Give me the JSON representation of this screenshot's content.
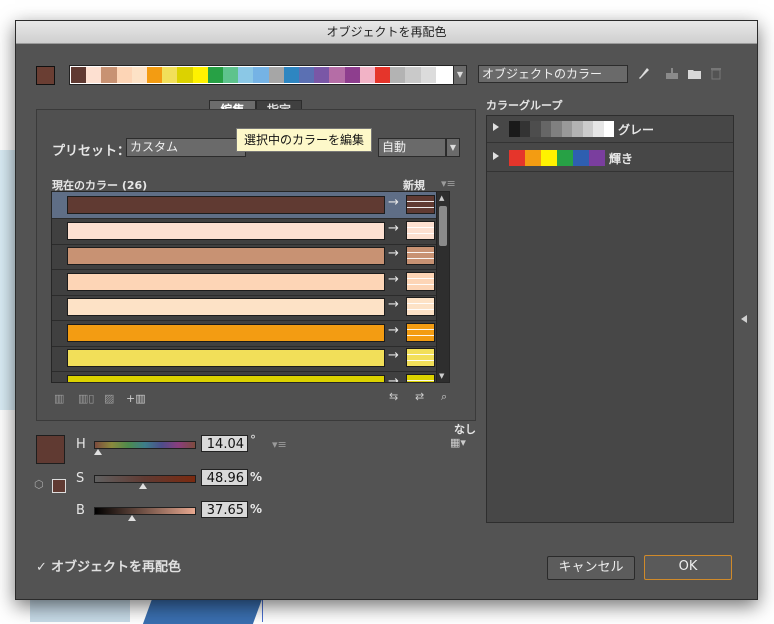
{
  "dialog": {
    "title": "オブジェクトを再配色"
  },
  "top": {
    "current_swatch_color": "#6a3e33",
    "strip_colors": [
      "#603a32",
      "#fde0d1",
      "#c89273",
      "#fdd5b6",
      "#fde2c6",
      "#f39c12",
      "#f2df59",
      "#dcd200",
      "#fff200",
      "#27a145",
      "#5ec38d",
      "#8bc8e6",
      "#75b3e5",
      "#a6a6a6",
      "#2e86c1",
      "#5b70b3",
      "#7a57a6",
      "#b56da6",
      "#8e3e8e",
      "#f2b3c6",
      "#e5352b",
      "#b3b3b3",
      "#c9c9c9",
      "#dcdcdc",
      "#ffffff"
    ],
    "object_color_dropdown": "オブジェクトのカラー",
    "icons": [
      "eyedropper-icon",
      "new-group-icon",
      "folder-icon",
      "trash-icon"
    ]
  },
  "tabs": {
    "edit": "編集",
    "assign": "指定"
  },
  "tooltip": "選択中のカラーを編集",
  "preset": {
    "label": "プリセット：",
    "value": "カスタム",
    "auto": "自動"
  },
  "current_colors": {
    "label": "現在のカラー (26)",
    "new_label": "新規",
    "rows": [
      {
        "color": "#603a32",
        "selected": true
      },
      {
        "color": "#fde0d1",
        "selected": false
      },
      {
        "color": "#c89273",
        "selected": false
      },
      {
        "color": "#fdd5b6",
        "selected": false
      },
      {
        "color": "#fde2c6",
        "selected": false
      },
      {
        "color": "#f39c12",
        "selected": false
      },
      {
        "color": "#f2df59",
        "selected": false
      },
      {
        "color": "#dcd200",
        "selected": false
      }
    ],
    "arrow": "→"
  },
  "hsb": {
    "h_label": "H",
    "s_label": "S",
    "b_label": "B",
    "h_value": "14.04",
    "s_value": "48.96",
    "b_value": "37.65",
    "h_unit": "°",
    "s_unit": "%",
    "b_unit": "%",
    "h_fraction": 0.04,
    "s_fraction": 0.49,
    "b_fraction": 0.38
  },
  "none_label": "なし",
  "color_groups": {
    "label": "カラーグループ",
    "groups": [
      {
        "name": "グレー",
        "colors": [
          "#1a1a1a",
          "#333",
          "#4d4d4d",
          "#666",
          "#808080",
          "#999",
          "#b3b3b3",
          "#ccc",
          "#e6e6e6",
          "#fff"
        ]
      },
      {
        "name": "輝き",
        "colors": [
          "#e5352b",
          "#f39c12",
          "#fff200",
          "#27a145",
          "#2e5fb0",
          "#7a3e9e"
        ]
      }
    ]
  },
  "recolor_checkbox": "オブジェクトを再配色",
  "buttons": {
    "cancel": "キャンセル",
    "ok": "OK"
  }
}
